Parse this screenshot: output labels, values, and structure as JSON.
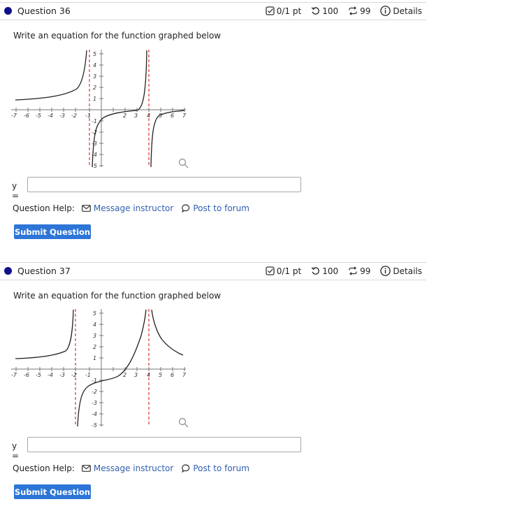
{
  "questions": [
    {
      "title": "Question 36",
      "score": "0/1 pt",
      "attempts": "100",
      "retries": "99",
      "details": "Details",
      "prompt": "Write an equation for the function graphed below",
      "answer_label": "y =",
      "answer_value": "",
      "help_label": "Question Help:",
      "message_label": "Message instructor",
      "forum_label": "Post to forum",
      "submit_label": "Submit Question",
      "graph": {
        "x_ticks": [
          "-7",
          "-6",
          "-5",
          "-4",
          "-3",
          "-2",
          "-1",
          "2",
          "3",
          "4",
          "5",
          "6",
          "7"
        ],
        "y_ticks": [
          "5",
          "4",
          "3",
          "2",
          "1",
          "-1",
          "-2",
          "-3",
          "-4",
          "-5"
        ],
        "asymptotes": [
          -1,
          4
        ]
      }
    },
    {
      "title": "Question 37",
      "score": "0/1 pt",
      "attempts": "100",
      "retries": "99",
      "details": "Details",
      "prompt": "Write an equation for the function graphed below",
      "answer_label": "y =",
      "answer_value": "",
      "help_label": "Question Help:",
      "message_label": "Message instructor",
      "forum_label": "Post to forum",
      "submit_label": "Submit Question",
      "graph": {
        "x_ticks": [
          "-7",
          "-6",
          "-5",
          "-4",
          "-3",
          "-2",
          "-1",
          "2",
          "3",
          "4",
          "5",
          "6",
          "7"
        ],
        "y_ticks": [
          "5",
          "4",
          "3",
          "2",
          "1",
          "-1",
          "-2",
          "-3",
          "-4",
          "-5"
        ],
        "asymptotes": [
          -2,
          4
        ]
      }
    }
  ],
  "icons": {
    "status_dot": "filled-circle",
    "score": "checkbox-icon",
    "attempts": "undo-icon",
    "retries": "repeat-icon",
    "details": "info-icon",
    "message": "envelope-icon",
    "forum": "speech-bubble-icon",
    "zoom": "magnifier-icon"
  },
  "colors": {
    "dot": "#10108a",
    "link": "#2f5fb0",
    "button": "#2d75d6",
    "asymptote": "#e03030"
  }
}
